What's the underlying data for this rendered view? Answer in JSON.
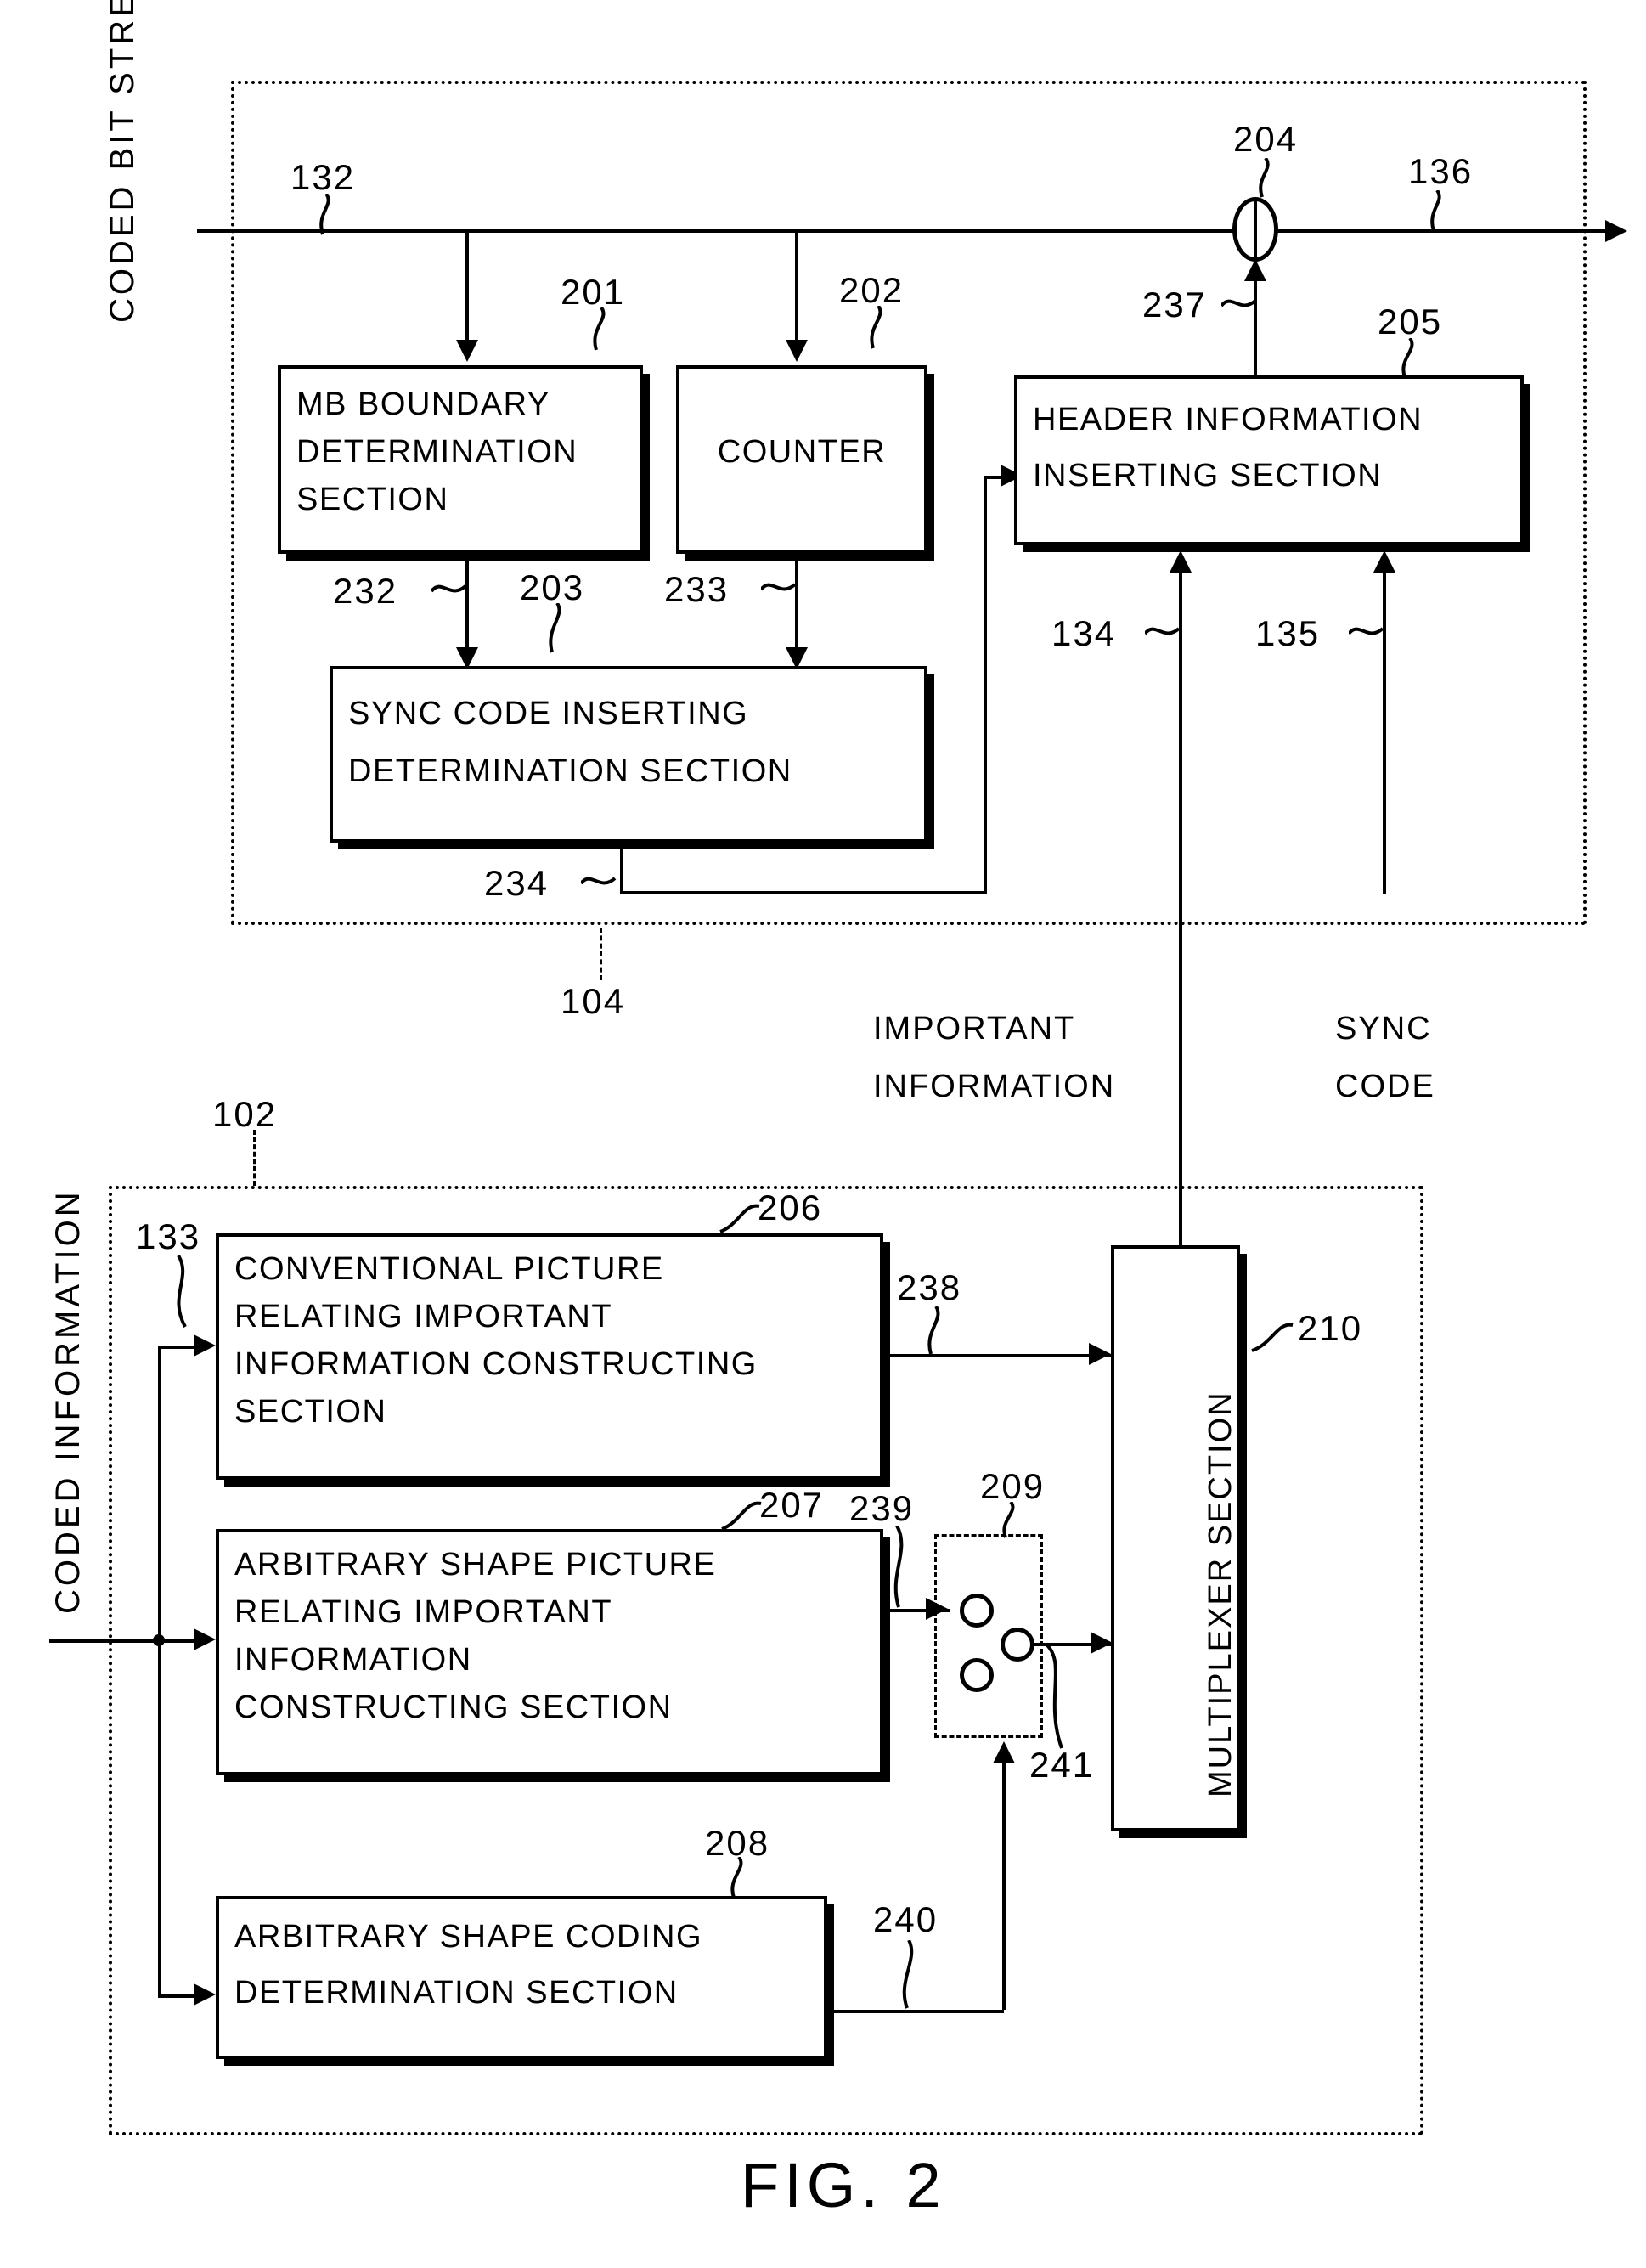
{
  "figure": {
    "label": "FIG. 2",
    "title_left_top": "CODED BIT STREAM",
    "title_left_bottom": "CODED INFORMATION"
  },
  "enclosures": [
    {
      "id": "104",
      "ref": "104"
    },
    {
      "id": "102",
      "ref": "102"
    },
    {
      "id": "209",
      "ref": "209"
    }
  ],
  "blocks": {
    "mb_boundary": {
      "ref": "201",
      "lines": [
        "MB BOUNDARY",
        "DETERMINATION",
        "SECTION"
      ]
    },
    "counter": {
      "ref": "202",
      "lines": [
        "COUNTER"
      ]
    },
    "sync_code_inserting": {
      "ref": "203",
      "lines": [
        "SYNC CODE INSERTING",
        "DETERMINATION SECTION"
      ]
    },
    "header_info_inserting": {
      "ref": "205",
      "lines": [
        "HEADER INFORMATION",
        "INSERTING SECTION"
      ]
    },
    "conventional_picture": {
      "ref": "206",
      "lines": [
        "CONVENTIONAL PICTURE",
        "RELATING IMPORTANT",
        "INFORMATION CONSTRUCTING",
        "SECTION"
      ]
    },
    "arbitrary_shape_picture": {
      "ref": "207",
      "lines": [
        "ARBITRARY SHAPE PICTURE",
        "RELATING IMPORTANT",
        "INFORMATION",
        "CONSTRUCTING SECTION"
      ]
    },
    "arbitrary_shape_coding": {
      "ref": "208",
      "lines": [
        "ARBITRARY SHAPE CODING",
        "DETERMINATION SECTION"
      ]
    },
    "multiplexer": {
      "ref": "210",
      "lines": [
        "MULTIPLEXER SECTION"
      ]
    },
    "adder": {
      "ref": "204"
    }
  },
  "signal_refs": {
    "input_stream": "132",
    "output_stream": "136",
    "coded_information": "133",
    "important_information_in": "134",
    "sync_code_in": "135",
    "mb_boundary_out": "232",
    "counter_out": "233",
    "sync_determination_out": "234",
    "header_out": "237",
    "conventional_out": "238",
    "arbitrary_picture_out": "239",
    "arbitrary_coding_out": "240",
    "switch_control": "241"
  },
  "annotations": {
    "important_information": [
      "IMPORTANT",
      "INFORMATION"
    ],
    "sync_code": [
      "SYNC",
      "CODE"
    ]
  }
}
